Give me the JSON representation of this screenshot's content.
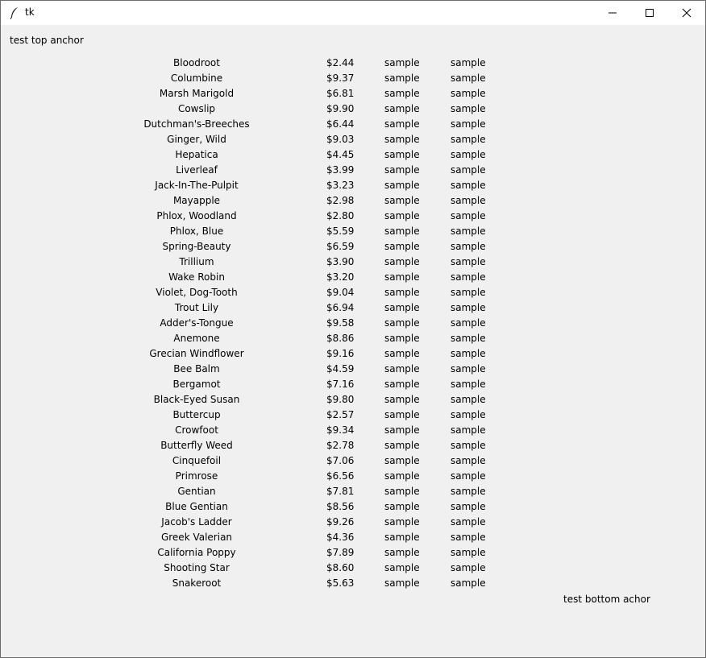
{
  "window": {
    "title": "tk"
  },
  "labels": {
    "top": "test top anchor",
    "bottom": "test bottom achor"
  },
  "rows": [
    {
      "name": "Bloodroot",
      "price": "$2.44",
      "s1": "sample",
      "s2": "sample"
    },
    {
      "name": "Columbine",
      "price": "$9.37",
      "s1": "sample",
      "s2": "sample"
    },
    {
      "name": "Marsh Marigold",
      "price": "$6.81",
      "s1": "sample",
      "s2": "sample"
    },
    {
      "name": "Cowslip",
      "price": "$9.90",
      "s1": "sample",
      "s2": "sample"
    },
    {
      "name": "Dutchman's-Breeches",
      "price": "$6.44",
      "s1": "sample",
      "s2": "sample"
    },
    {
      "name": "Ginger, Wild",
      "price": "$9.03",
      "s1": "sample",
      "s2": "sample"
    },
    {
      "name": "Hepatica",
      "price": "$4.45",
      "s1": "sample",
      "s2": "sample"
    },
    {
      "name": "Liverleaf",
      "price": "$3.99",
      "s1": "sample",
      "s2": "sample"
    },
    {
      "name": "Jack-In-The-Pulpit",
      "price": "$3.23",
      "s1": "sample",
      "s2": "sample"
    },
    {
      "name": "Mayapple",
      "price": "$2.98",
      "s1": "sample",
      "s2": "sample"
    },
    {
      "name": "Phlox, Woodland",
      "price": "$2.80",
      "s1": "sample",
      "s2": "sample"
    },
    {
      "name": "Phlox, Blue",
      "price": "$5.59",
      "s1": "sample",
      "s2": "sample"
    },
    {
      "name": "Spring-Beauty",
      "price": "$6.59",
      "s1": "sample",
      "s2": "sample"
    },
    {
      "name": "Trillium",
      "price": "$3.90",
      "s1": "sample",
      "s2": "sample"
    },
    {
      "name": "Wake Robin",
      "price": "$3.20",
      "s1": "sample",
      "s2": "sample"
    },
    {
      "name": "Violet, Dog-Tooth",
      "price": "$9.04",
      "s1": "sample",
      "s2": "sample"
    },
    {
      "name": "Trout Lily",
      "price": "$6.94",
      "s1": "sample",
      "s2": "sample"
    },
    {
      "name": "Adder's-Tongue",
      "price": "$9.58",
      "s1": "sample",
      "s2": "sample"
    },
    {
      "name": "Anemone",
      "price": "$8.86",
      "s1": "sample",
      "s2": "sample"
    },
    {
      "name": "Grecian Windflower",
      "price": "$9.16",
      "s1": "sample",
      "s2": "sample"
    },
    {
      "name": "Bee Balm",
      "price": "$4.59",
      "s1": "sample",
      "s2": "sample"
    },
    {
      "name": "Bergamot",
      "price": "$7.16",
      "s1": "sample",
      "s2": "sample"
    },
    {
      "name": "Black-Eyed Susan",
      "price": "$9.80",
      "s1": "sample",
      "s2": "sample"
    },
    {
      "name": "Buttercup",
      "price": "$2.57",
      "s1": "sample",
      "s2": "sample"
    },
    {
      "name": "Crowfoot",
      "price": "$9.34",
      "s1": "sample",
      "s2": "sample"
    },
    {
      "name": "Butterfly Weed",
      "price": "$2.78",
      "s1": "sample",
      "s2": "sample"
    },
    {
      "name": "Cinquefoil",
      "price": "$7.06",
      "s1": "sample",
      "s2": "sample"
    },
    {
      "name": "Primrose",
      "price": "$6.56",
      "s1": "sample",
      "s2": "sample"
    },
    {
      "name": "Gentian",
      "price": "$7.81",
      "s1": "sample",
      "s2": "sample"
    },
    {
      "name": "Blue Gentian",
      "price": "$8.56",
      "s1": "sample",
      "s2": "sample"
    },
    {
      "name": "Jacob's Ladder",
      "price": "$9.26",
      "s1": "sample",
      "s2": "sample"
    },
    {
      "name": "Greek Valerian",
      "price": "$4.36",
      "s1": "sample",
      "s2": "sample"
    },
    {
      "name": "California Poppy",
      "price": "$7.89",
      "s1": "sample",
      "s2": "sample"
    },
    {
      "name": "Shooting Star",
      "price": "$8.60",
      "s1": "sample",
      "s2": "sample"
    },
    {
      "name": "Snakeroot",
      "price": "$5.63",
      "s1": "sample",
      "s2": "sample"
    }
  ]
}
